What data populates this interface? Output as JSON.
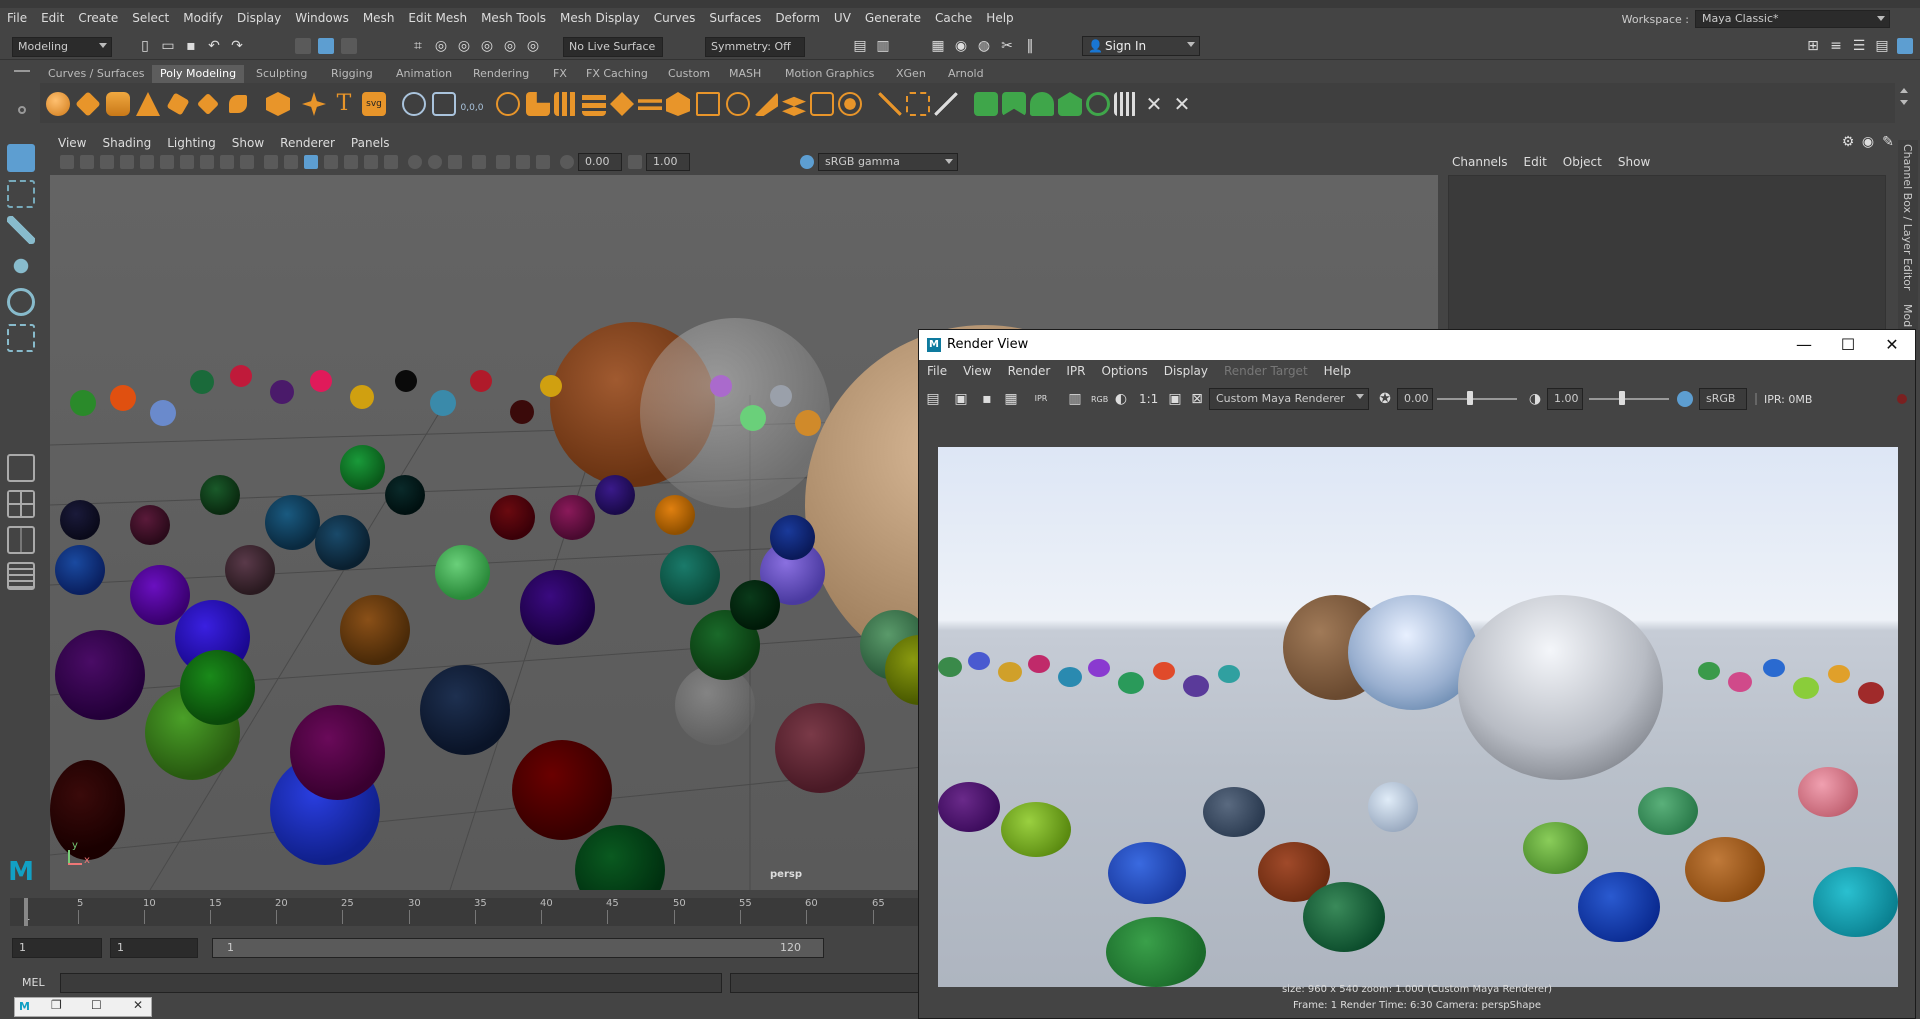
{
  "menubar": {
    "items": [
      "File",
      "Edit",
      "Create",
      "Select",
      "Modify",
      "Display",
      "Windows",
      "Mesh",
      "Edit Mesh",
      "Mesh Tools",
      "Mesh Display",
      "Curves",
      "Surfaces",
      "Deform",
      "UV",
      "Generate",
      "Cache",
      "Help"
    ],
    "workspace_label": "Workspace :",
    "workspace_value": "Maya Classic*"
  },
  "statusline": {
    "mode": "Modeling",
    "live_surface": "No Live Surface",
    "symmetry": "Symmetry: Off",
    "sign_in": "Sign In"
  },
  "shelf": {
    "tabs": [
      "Curves / Surfaces",
      "Poly Modeling",
      "Sculpting",
      "Rigging",
      "Animation",
      "Rendering",
      "FX",
      "FX Caching",
      "Custom",
      "MASH",
      "Motion Graphics",
      "XGen",
      "Arnold"
    ],
    "active_tab": "Poly Modeling",
    "text_icon": "T",
    "svg_icon": "svg",
    "coord_icon": "0,0,0"
  },
  "viewport": {
    "menu": [
      "View",
      "Shading",
      "Lighting",
      "Show",
      "Renderer",
      "Panels"
    ],
    "field_a": "0.00",
    "field_b": "1.00",
    "color_space": "sRGB gamma",
    "camera_label": "persp",
    "axis_y": "y",
    "axis_x": "x"
  },
  "timeline": {
    "ticks": [
      "5",
      "10",
      "15",
      "20",
      "25",
      "30",
      "35",
      "40",
      "45",
      "50",
      "55",
      "60",
      "65"
    ],
    "current": "1",
    "start_field": "1",
    "start_field2": "1",
    "range_start": "1",
    "range_end": "120"
  },
  "commandline": {
    "label": "MEL"
  },
  "channelbox": {
    "menu": [
      "Channels",
      "Edit",
      "Object",
      "Show"
    ],
    "side_label": "Channel Box / Layer Editor",
    "side_label2": "Mod"
  },
  "render_view": {
    "title": "Render View",
    "logo_letter": "M",
    "menu": [
      "File",
      "View",
      "Render",
      "IPR",
      "Options",
      "Display",
      "Render Target",
      "Help"
    ],
    "disabled_menu": "Render Target",
    "rgb_label": "RGB",
    "ratio_label": "1:1",
    "renderer": "Custom Maya Renderer",
    "exposure": "0.00",
    "gamma": "1.00",
    "color_space": "sRGB ga",
    "ipr_mem": "IPR: 0MB",
    "info_line1": "size: 960 x 540  zoom: 1.000        (Custom Maya Renderer)",
    "info_line2": "Frame: 1        Render Time:  6:30        Camera: perspShape",
    "window_controls": {
      "minimize": "—",
      "maximize": "☐",
      "close": "✕"
    }
  },
  "icon_colors": {
    "accent_blue": "#5d9ed1",
    "shelf_orange": "#e8952a",
    "shelf_green": "#3fa64a",
    "maya_teal": "#12a0c4"
  }
}
